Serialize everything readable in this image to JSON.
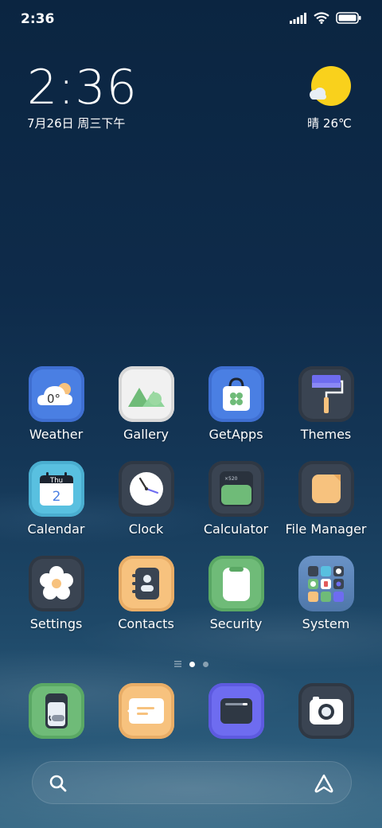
{
  "status_bar": {
    "time": "2:36"
  },
  "clock_widget": {
    "time": "2:36",
    "date": "7月26日 周三下午"
  },
  "weather_widget": {
    "text": "晴 26℃"
  },
  "apps": [
    {
      "label": "Weather",
      "icon": "weather-icon",
      "temp": "0°"
    },
    {
      "label": "Gallery",
      "icon": "gallery-icon"
    },
    {
      "label": "GetApps",
      "icon": "getapps-icon"
    },
    {
      "label": "Themes",
      "icon": "themes-icon"
    },
    {
      "label": "Calendar",
      "icon": "calendar-icon",
      "weekday": "Thu",
      "day": "2"
    },
    {
      "label": "Clock",
      "icon": "clock-icon"
    },
    {
      "label": "Calculator",
      "icon": "calculator-icon",
      "display": "×520"
    },
    {
      "label": "File Manager",
      "icon": "folder-icon"
    },
    {
      "label": "Settings",
      "icon": "gear-flower-icon"
    },
    {
      "label": "Contacts",
      "icon": "contacts-icon"
    },
    {
      "label": "Security",
      "icon": "security-icon"
    },
    {
      "label": "System",
      "icon": "folder-apps-icon"
    }
  ],
  "dock": [
    {
      "icon": "phone-icon"
    },
    {
      "icon": "messages-icon"
    },
    {
      "icon": "browser-icon"
    },
    {
      "icon": "camera-icon"
    }
  ],
  "colors": {
    "blue": "#4a7fe3",
    "green": "#6fbb78",
    "orange": "#f7c27e",
    "purple": "#6e6cf0",
    "dark": "#3a4452"
  }
}
